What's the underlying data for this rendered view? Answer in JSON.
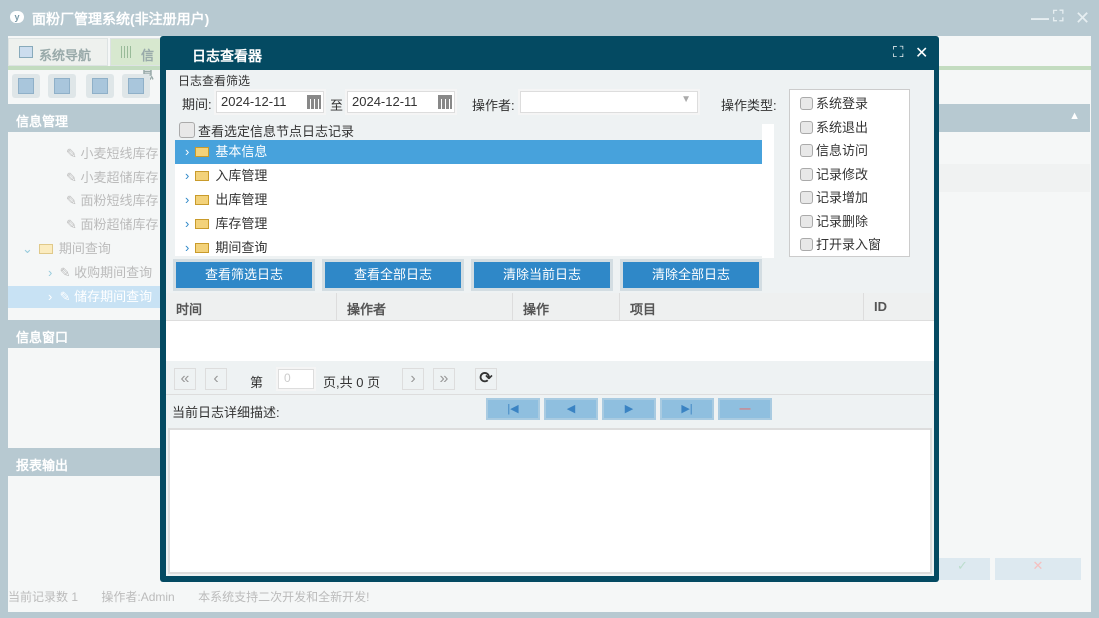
{
  "app": {
    "title": "面粉厂管理系统(非注册用户)",
    "logo": "y"
  },
  "tabs": [
    {
      "label": "系统导航"
    },
    {
      "label": "信息"
    }
  ],
  "left": {
    "sections": [
      "信息管理",
      "信息窗口",
      "报表输出"
    ],
    "tree": [
      {
        "label": "小麦短线库存"
      },
      {
        "label": "小麦超储库存"
      },
      {
        "label": "面粉短线库存"
      },
      {
        "label": "面粉超储库存"
      },
      {
        "label": "期间查询"
      },
      {
        "label": "收购期间查询"
      },
      {
        "label": "储存期间查询"
      }
    ]
  },
  "status": {
    "records": "当前记录数 1",
    "operator": "操作者:Admin",
    "note": "本系统支持二次开发和全新开发!"
  },
  "dialog": {
    "title": "日志查看器",
    "filter_title": "日志查看筛选",
    "period_label": "期间:",
    "from": "2024-12-11",
    "to_label": "至",
    "to": "2024-12-11",
    "operator_label": "操作者:",
    "operator_value": "",
    "type_label": "操作类型:",
    "types": [
      "系统登录",
      "系统退出",
      "信息访问",
      "记录修改",
      "记录增加",
      "记录删除",
      "打开录入窗"
    ],
    "node_check": "查看选定信息节点日志记录",
    "nodes": [
      "基本信息",
      "入库管理",
      "出库管理",
      "库存管理",
      "期间查询"
    ],
    "buttons": [
      "查看筛选日志",
      "查看全部日志",
      "清除当前日志",
      "清除全部日志"
    ],
    "columns": [
      "时间",
      "操作者",
      "操作",
      "项目",
      "ID"
    ],
    "pager": {
      "page_prefix": "第",
      "page": "0",
      "page_suffix": "页,共 0 页"
    },
    "detail_label": "当前日志详细描述:"
  },
  "colors": {
    "dialog_border": "#044a62",
    "selected": "#47a2dc",
    "button": "#2f88c8"
  }
}
